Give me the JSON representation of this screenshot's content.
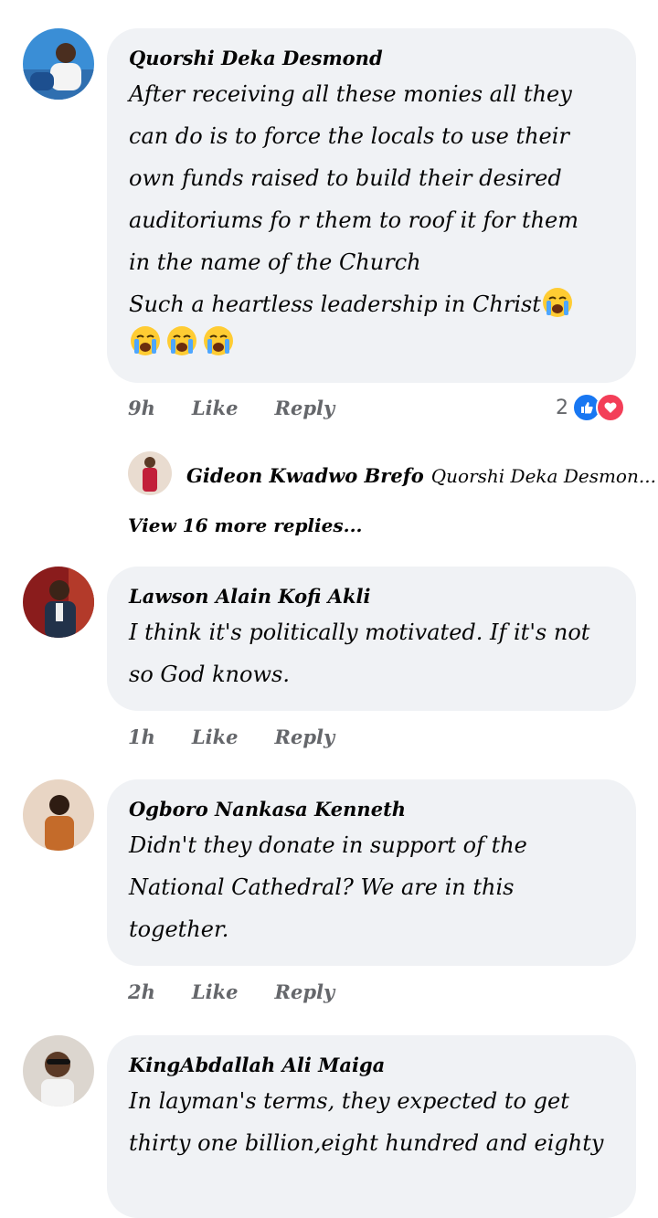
{
  "comments": [
    {
      "author": "Quorshi Deka Desmond",
      "lines": [
        "After receiving all these monies all they",
        "can do is to force the locals to use their",
        "own funds raised to build their desired",
        "auditoriums fo r them to roof it for them",
        "in the name of the Church",
        "Such a heartless leadership in Christ"
      ],
      "time": "9h",
      "like": "Like",
      "reply": "Reply",
      "reaction_count": "2",
      "reply_author": "Gideon Kwadwo Brefo",
      "reply_preview": "Quorshi Deka Desmon...",
      "view_more": "View 16 more replies..."
    },
    {
      "author": "Lawson Alain Kofi Akli",
      "lines": [
        "I think it's politically motivated. If it's not",
        "so God knows."
      ],
      "time": "1h",
      "like": "Like",
      "reply": "Reply"
    },
    {
      "author": "Ogboro Nankasa Kenneth",
      "lines": [
        "Didn't they donate in support of the",
        "National Cathedral? We are in this",
        "together."
      ],
      "time": "2h",
      "like": "Like",
      "reply": "Reply"
    },
    {
      "author": "KingAbdallah Ali Maiga",
      "lines": [
        "In layman's terms, they expected to get",
        "thirty one billion,eight hundred and eighty"
      ]
    }
  ],
  "colors": {
    "bubble": "#f0f2f5",
    "meta": "#65676b",
    "like_blue": "#1877f2",
    "love_red": "#f33e58"
  },
  "icons": [
    "crying-face-icon",
    "like-reaction-icon",
    "love-reaction-icon"
  ]
}
